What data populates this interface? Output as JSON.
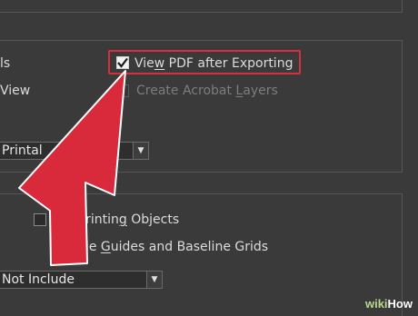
{
  "options": {
    "left_label_1": "ls",
    "left_label_2": "View",
    "view_pdf_after_exporting": {
      "label": "View PDF after Exporting",
      "checked": true
    },
    "create_acrobat_layers": {
      "label": "Create Acrobat Layers",
      "checked": false,
      "enabled": false
    },
    "printable_select": {
      "value": "Printal"
    }
  },
  "include": {
    "non_printing_objects": {
      "label": "n-Printing Objects",
      "checked": false
    },
    "visible_guides_and_baseline_grids": {
      "label": "isible Guides and Baseline Grids"
    },
    "include_select": {
      "value": "Not Include"
    }
  },
  "watermark": {
    "wiki": "wiki",
    "how": "How"
  },
  "colors": {
    "highlight": "#d6303e",
    "arrow": "#d92a3c",
    "background": "#3a3a3a"
  }
}
